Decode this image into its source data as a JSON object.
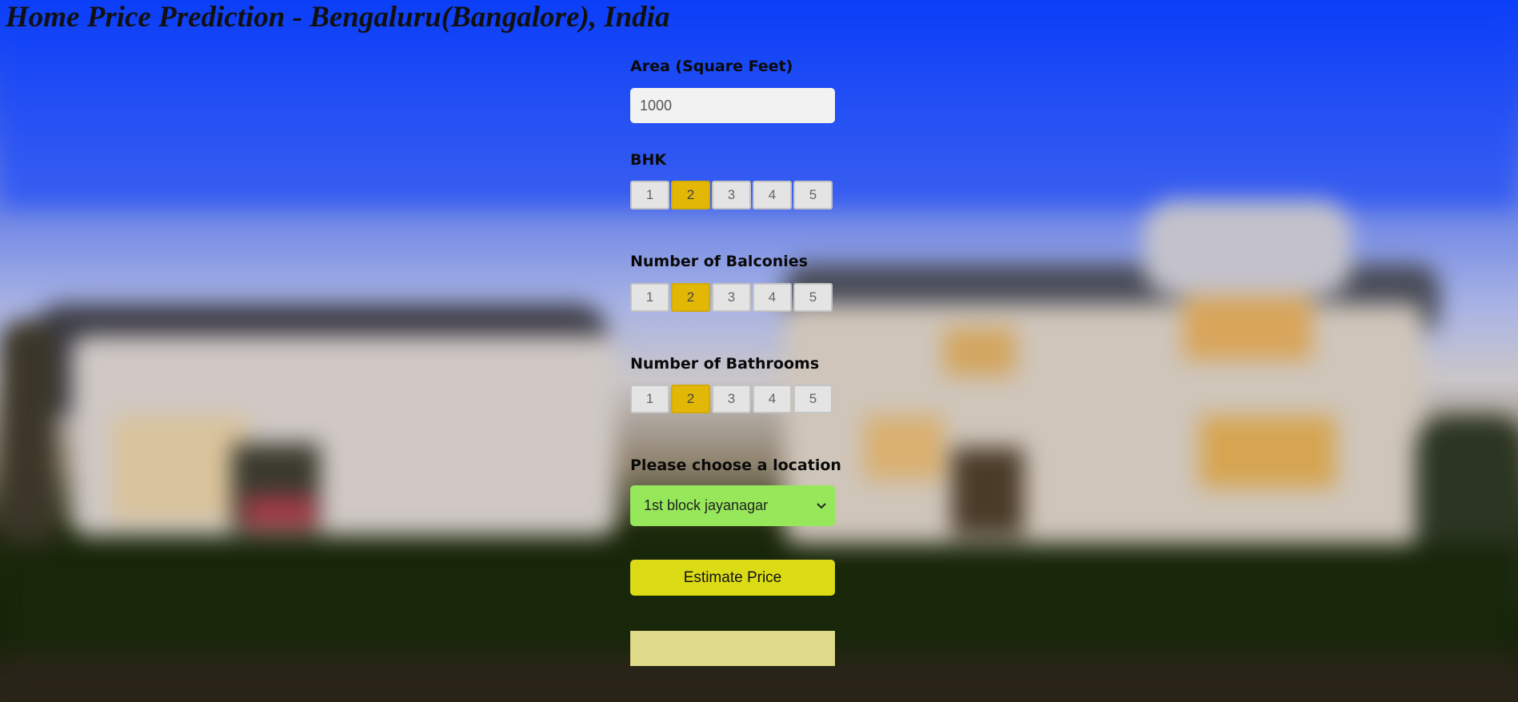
{
  "page": {
    "title": "Home Price Prediction - Bengaluru(Bangalore), India"
  },
  "form": {
    "area": {
      "label": "Area (Square Feet)",
      "value": "1000"
    },
    "bhk": {
      "label": "BHK",
      "options": [
        "1",
        "2",
        "3",
        "4",
        "5"
      ],
      "selected": "2"
    },
    "balconies": {
      "label": "Number of Balconies",
      "options": [
        "1",
        "2",
        "3",
        "4",
        "5"
      ],
      "selected": "2"
    },
    "bathrooms": {
      "label": "Number of Bathrooms",
      "options": [
        "1",
        "2",
        "3",
        "4",
        "5"
      ],
      "selected": "2"
    },
    "location": {
      "label": "Please choose a location",
      "selected": "1st block jayanagar"
    },
    "estimate_label": "Estimate Price",
    "result": ""
  },
  "colors": {
    "selected_option": "#e2b705",
    "location_select": "#96e85a",
    "estimate_button": "#dcdc16",
    "result_box": "#dfd98a"
  },
  "icons": {
    "location_dropdown": "chevron-down-icon"
  }
}
